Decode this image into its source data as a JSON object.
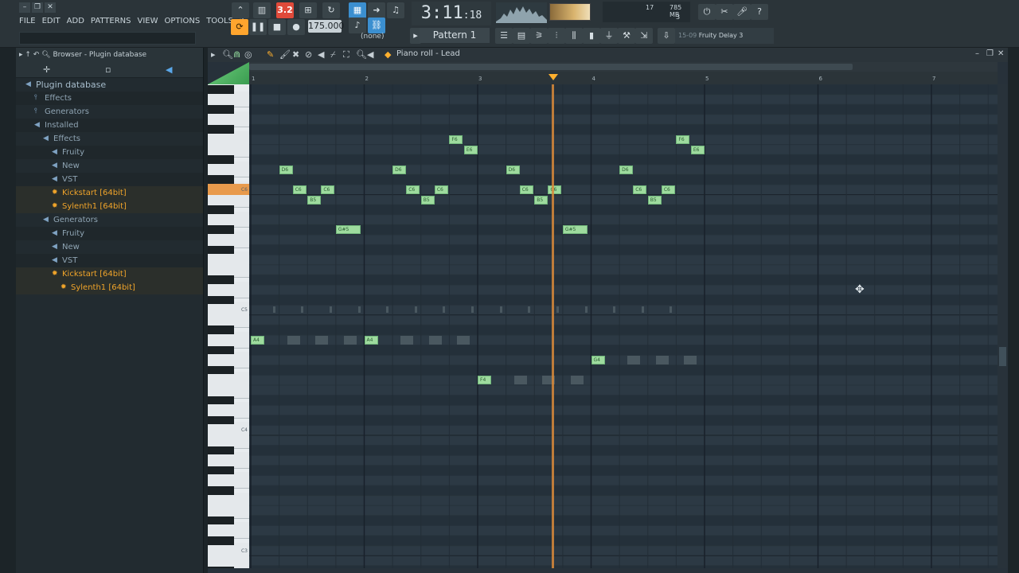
{
  "menu": [
    "FILE",
    "EDIT",
    "ADD",
    "PATTERNS",
    "VIEW",
    "OPTIONS",
    "TOOLS",
    "?"
  ],
  "transport": {
    "time_main": "3:11",
    "time_sub": "18",
    "tempo": "175.000",
    "pattern": "Pattern 1",
    "snap": "(none)",
    "pat_label": "3.2"
  },
  "cpu": {
    "memory": "785 MB",
    "voices": "17",
    "poly": "3"
  },
  "hint_bar": {
    "num": "15-09",
    "text": "Fruity Delay 3"
  },
  "browser": {
    "header": "Browser - Plugin database",
    "items": [
      {
        "label": "Plugin database",
        "level": 0,
        "kind": "root"
      },
      {
        "label": "Effects",
        "level": 1,
        "kind": "cat"
      },
      {
        "label": "Generators",
        "level": 1,
        "kind": "cat"
      },
      {
        "label": "Installed",
        "level": 1,
        "kind": "folder"
      },
      {
        "label": "Effects",
        "level": 2,
        "kind": "folder"
      },
      {
        "label": "Fruity",
        "level": 3,
        "kind": "folder"
      },
      {
        "label": "New",
        "level": 3,
        "kind": "folder"
      },
      {
        "label": "VST",
        "level": 3,
        "kind": "folder"
      },
      {
        "label": "Kickstart [64bit]",
        "level": 3,
        "kind": "vst"
      },
      {
        "label": "Sylenth1 [64bit]",
        "level": 3,
        "kind": "vst"
      },
      {
        "label": "Generators",
        "level": 2,
        "kind": "folder"
      },
      {
        "label": "Fruity",
        "level": 3,
        "kind": "folder"
      },
      {
        "label": "New",
        "level": 3,
        "kind": "folder"
      },
      {
        "label": "VST",
        "level": 3,
        "kind": "folder"
      },
      {
        "label": "Kickstart [64bit]",
        "level": 3,
        "kind": "vst"
      },
      {
        "label": "Sylenth1 [64bit]",
        "level": 4,
        "kind": "vst"
      }
    ]
  },
  "piano_roll": {
    "title": "Piano roll - Lead",
    "bars": [
      "1",
      "2",
      "3",
      "4",
      "5",
      "6",
      "7"
    ],
    "key_labels": [
      "C6",
      "C5",
      "C4",
      "C3"
    ],
    "playhead_bar": 3.66,
    "notes": [
      {
        "label": "F6",
        "bar": 2.75,
        "len": 0.12
      },
      {
        "label": "E6",
        "bar": 2.88,
        "len": 0.12
      },
      {
        "label": "D6",
        "bar": 1.25,
        "len": 0.12
      },
      {
        "label": "C6",
        "bar": 1.37,
        "len": 0.12
      },
      {
        "label": "B5",
        "bar": 1.5,
        "len": 0.12
      },
      {
        "label": "C6",
        "bar": 1.62,
        "len": 0.12
      },
      {
        "label": "G#5",
        "bar": 1.75,
        "len": 0.22
      },
      {
        "label": "D6",
        "bar": 2.25,
        "len": 0.12
      },
      {
        "label": "C6",
        "bar": 2.37,
        "len": 0.12
      },
      {
        "label": "B5",
        "bar": 2.5,
        "len": 0.12
      },
      {
        "label": "C6",
        "bar": 2.62,
        "len": 0.12
      },
      {
        "label": "D6",
        "bar": 3.25,
        "len": 0.12
      },
      {
        "label": "C6",
        "bar": 3.37,
        "len": 0.12
      },
      {
        "label": "B5",
        "bar": 3.5,
        "len": 0.12
      },
      {
        "label": "C6",
        "bar": 3.62,
        "len": 0.12
      },
      {
        "label": "G#5",
        "bar": 3.75,
        "len": 0.22
      },
      {
        "label": "D6",
        "bar": 4.25,
        "len": 0.12
      },
      {
        "label": "C6",
        "bar": 4.37,
        "len": 0.12
      },
      {
        "label": "B5",
        "bar": 4.5,
        "len": 0.12
      },
      {
        "label": "C6",
        "bar": 4.62,
        "len": 0.12
      },
      {
        "label": "F6",
        "bar": 4.75,
        "len": 0.12
      },
      {
        "label": "E6",
        "bar": 4.88,
        "len": 0.12
      },
      {
        "label": "A4",
        "bar": 1.0,
        "len": 0.12
      },
      {
        "label": "A4",
        "bar": 2.0,
        "len": 0.12
      },
      {
        "label": "G4",
        "bar": 4.0,
        "len": 0.12
      },
      {
        "label": "F4",
        "bar": 3.0,
        "len": 0.12
      }
    ]
  }
}
